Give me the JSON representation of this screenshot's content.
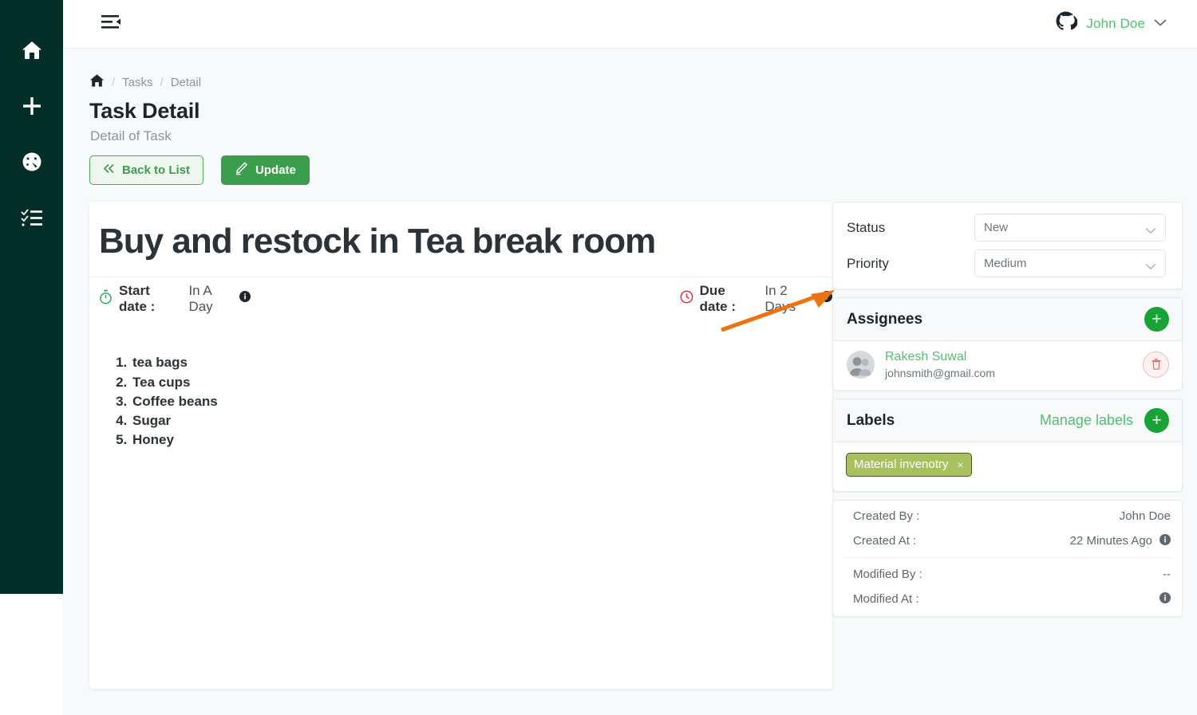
{
  "colors": {
    "rail_bg": "#042f28",
    "page_bg": "#f6fafb",
    "accent_green": "#4fbf6f",
    "solid_green": "#3a9e4c",
    "label_chip": "#a9c05e",
    "label_chip_border": "#3c5a25",
    "due_red": "#e8232a",
    "start_green": "#26a65b",
    "annotation_orange": "#ef7211"
  },
  "rail": {
    "items": [
      {
        "name": "home-icon",
        "label": "Home"
      },
      {
        "name": "plus-icon",
        "label": "Add"
      },
      {
        "name": "speedometer-icon",
        "label": "Dashboard"
      },
      {
        "name": "task-list-icon",
        "label": "Tasks"
      }
    ]
  },
  "topbar": {
    "collapse_icon": "menu-collapse-icon",
    "brand_icon": "github-icon",
    "user_name": "John Doe",
    "chevron_icon": "chevron-down-icon"
  },
  "breadcrumb": {
    "home_icon": "home-icon",
    "sep": "/",
    "items": [
      {
        "label": "Tasks"
      },
      {
        "label": "Detail"
      }
    ]
  },
  "header": {
    "title": "Task Detail",
    "subtitle": "Detail of Task"
  },
  "actions": {
    "back": {
      "label": "Back to List",
      "icon": "chevron-double-left-icon"
    },
    "update": {
      "label": "Update",
      "icon": "pencil-icon"
    }
  },
  "task": {
    "title": "Buy and restock in Tea break room",
    "start_date": {
      "label": "Start date :",
      "value": "In A Day",
      "icon": "stopwatch-icon",
      "info_icon": "info-icon"
    },
    "due_date": {
      "label": "Due date :",
      "value": "In 2 Days",
      "icon": "clock-icon",
      "info_icon": "info-icon"
    },
    "description_items": [
      "tea bags",
      "Tea cups",
      "Coffee beans",
      "Sugar",
      "Honey"
    ]
  },
  "status_panel": {
    "status": {
      "label": "Status",
      "value": "New",
      "chevron_icon": "chevron-down-icon"
    },
    "priority": {
      "label": "Priority",
      "value": "Medium",
      "chevron_icon": "chevron-down-icon"
    }
  },
  "assignees": {
    "heading": "Assignees",
    "add_icon": "plus-icon",
    "add_label": "+",
    "rows": [
      {
        "name": "Rakesh Suwal",
        "email": "johnsmith@gmail.com",
        "avatar_icon": "users-avatar-icon",
        "delete_icon": "trash-icon"
      }
    ]
  },
  "labels": {
    "heading": "Labels",
    "manage_link": "Manage labels",
    "add_label": "+",
    "add_icon": "plus-icon",
    "chips": [
      {
        "text": "Material invenotry",
        "remove_icon": "close-icon",
        "remove_label": "×"
      }
    ]
  },
  "meta": {
    "rows": [
      {
        "key": "Created By :",
        "value": "John Doe",
        "info": false
      },
      {
        "key": "Created At :",
        "value": "22 Minutes Ago",
        "info": true
      },
      {
        "key": "Modified By :",
        "value": "--",
        "info": false
      },
      {
        "key": "Modified At :",
        "value": "",
        "info": true
      }
    ]
  },
  "annotation": {
    "name": "status-pointer-arrow",
    "target": "Status"
  }
}
